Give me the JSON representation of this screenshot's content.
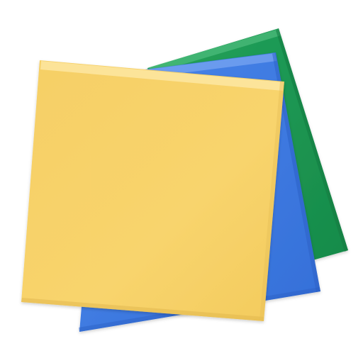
{
  "icon": {
    "name": "sticky-notes-stack",
    "notes": [
      {
        "id": "green",
        "color": "#1f9d55",
        "shade": "#137a40",
        "highlight": "#56c07f"
      },
      {
        "id": "blue",
        "color": "#3f7fe6",
        "shade": "#2a5fc4",
        "highlight": "#7ea8f2"
      },
      {
        "id": "yellow",
        "color": "#f8d36a",
        "shade": "#e2b84e",
        "highlight": "#fbe7a8"
      }
    ]
  }
}
